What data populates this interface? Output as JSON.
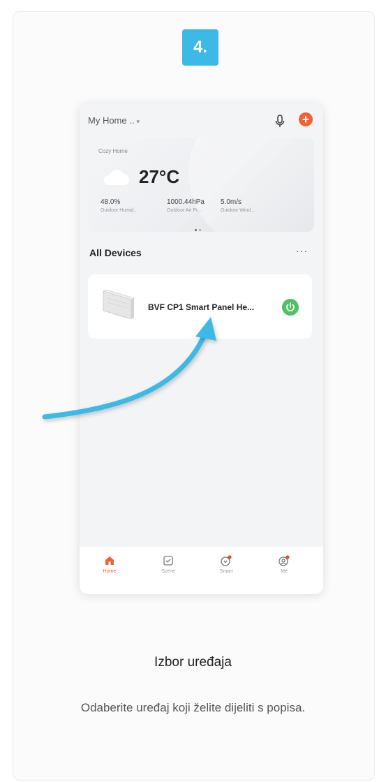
{
  "step": {
    "number": "4."
  },
  "phone": {
    "header": {
      "home_label": "My Home ..",
      "caret": "▾"
    },
    "weather": {
      "location": "Cozy Home",
      "temperature": "27°C",
      "stats": [
        {
          "value": "48.0%",
          "label": "Outdoor Humid..."
        },
        {
          "value": "1000.44hPa",
          "label": "Outdoor Air Pr..."
        },
        {
          "value": "5.0m/s",
          "label": "Outdoor Wind..."
        }
      ]
    },
    "section": {
      "title": "All Devices",
      "more": "···"
    },
    "device": {
      "name": "BVF CP1 Smart Panel He..."
    },
    "tabs": [
      {
        "label": "Home",
        "icon": "home-icon"
      },
      {
        "label": "Scene",
        "icon": "scene-icon"
      },
      {
        "label": "Smart",
        "icon": "smart-icon"
      },
      {
        "label": "Me",
        "icon": "me-icon"
      }
    ]
  },
  "caption": {
    "title": "Izbor uređaja",
    "text": "Odaberite uređaj koji želite dijeliti s popisa."
  },
  "colors": {
    "accent": "#3cb9e6",
    "brand": "#f06134",
    "power": "#4cc35f"
  }
}
